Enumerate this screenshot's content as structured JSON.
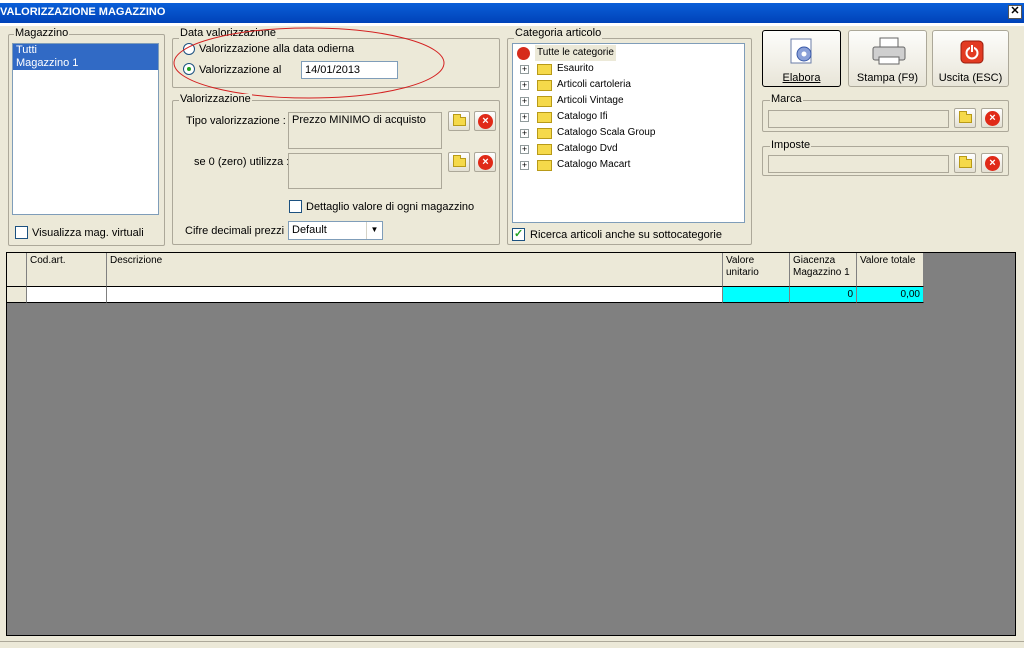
{
  "window": {
    "title": "VALORIZZAZIONE MAGAZZINO",
    "close_glyph": "✕"
  },
  "magazzino": {
    "legend": "Magazzino",
    "items": [
      "Tutti",
      "Magazzino 1"
    ],
    "virtual_checkbox_label": "Visualizza mag. virtuali",
    "virtual_checked": false
  },
  "data_valorizzazione": {
    "legend": "Data valorizzazione",
    "option_today": "Valorizzazione alla data odierna",
    "option_date": "Valorizzazione al",
    "selected": "date",
    "date_value": "14/01/2013"
  },
  "valorizzazione": {
    "legend": "Valorizzazione",
    "tipo_label": "Tipo valorizzazione :",
    "tipo_value": "Prezzo MINIMO di acquisto",
    "zero_label": "se 0 (zero) utilizza :",
    "zero_value": "",
    "dettaglio_label": "Dettaglio valore di ogni magazzino",
    "dettaglio_checked": false,
    "cifre_label": "Cifre decimali prezzi :",
    "cifre_value": "Default"
  },
  "categoria": {
    "legend": "Categoria articolo",
    "root": "Tutte le categorie",
    "items": [
      "Esaurito",
      "Articoli cartoleria",
      "Articoli Vintage",
      "Catalogo Ifi",
      "Catalogo Scala Group",
      "Catalogo Dvd",
      "Catalogo Macart"
    ],
    "subcat_label": "Ricerca articoli anche su sottocategorie",
    "subcat_checked": true
  },
  "buttons": {
    "elabora": "Elabora",
    "stampa": "Stampa (F9)",
    "uscita": "Uscita (ESC)"
  },
  "marca": {
    "legend": "Marca",
    "value": ""
  },
  "imposte": {
    "legend": "Imposte",
    "value": ""
  },
  "grid": {
    "headers": {
      "cod": "Cod.art.",
      "desc": "Descrizione",
      "valore_unitario": "Valore unitario",
      "giacenza": "Giacenza Magazzino 1",
      "valore_totale": "Valore totale"
    },
    "row": {
      "cod": "",
      "desc": "",
      "valore_unitario": "",
      "giacenza": "0",
      "valore_totale": "0,00"
    }
  },
  "colors": {
    "titlebar": "#0a5fd8",
    "selection": "#316ac5",
    "highlight_cell": "#00ffff",
    "annotation": "#d42020",
    "grid_bg": "#808080"
  }
}
